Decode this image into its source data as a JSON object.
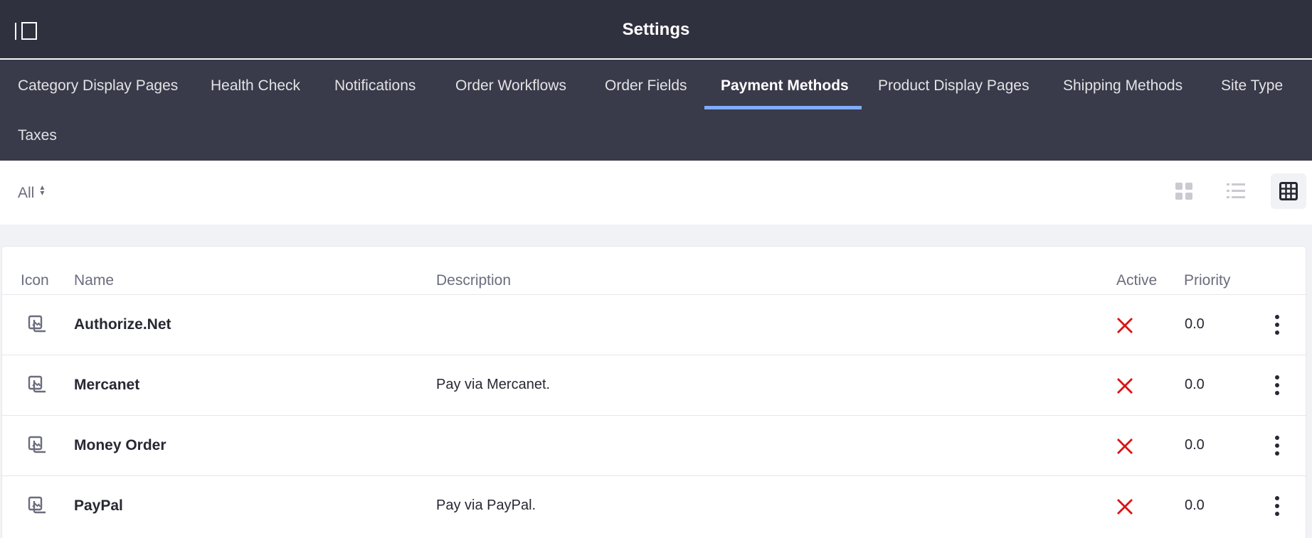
{
  "header": {
    "title": "Settings"
  },
  "tabs": [
    {
      "label": "Category Display Pages",
      "active": false
    },
    {
      "label": "Health Check",
      "active": false
    },
    {
      "label": "Notifications",
      "active": false
    },
    {
      "label": "Order Workflows",
      "active": false
    },
    {
      "label": "Order Fields",
      "active": false
    },
    {
      "label": "Payment Methods",
      "active": true
    },
    {
      "label": "Product Display Pages",
      "active": false
    },
    {
      "label": "Shipping Methods",
      "active": false
    },
    {
      "label": "Site Type",
      "active": false
    },
    {
      "label": "Taxes",
      "active": false
    }
  ],
  "toolbar": {
    "filter_label": "All",
    "views": [
      {
        "icon": "cards-icon",
        "active": false
      },
      {
        "icon": "list-icon",
        "active": false
      },
      {
        "icon": "table-icon",
        "active": true
      }
    ]
  },
  "table": {
    "columns": [
      "Icon",
      "Name",
      "Description",
      "Active",
      "Priority"
    ],
    "rows": [
      {
        "icon": "image-stack-icon",
        "name": "Authorize.Net",
        "description": "",
        "active": false,
        "priority": "0.0"
      },
      {
        "icon": "image-stack-icon",
        "name": "Mercanet",
        "description": "Pay via Mercanet.",
        "active": false,
        "priority": "0.0"
      },
      {
        "icon": "image-stack-icon",
        "name": "Money Order",
        "description": "",
        "active": false,
        "priority": "0.0"
      },
      {
        "icon": "image-stack-icon",
        "name": "PayPal",
        "description": "Pay via PayPal.",
        "active": false,
        "priority": "0.0"
      }
    ]
  },
  "colors": {
    "header_bg": "#30313f",
    "tabnav_bg": "#393a4a",
    "tab_active_underline": "#80acff",
    "inactive_x": "#da1414"
  }
}
